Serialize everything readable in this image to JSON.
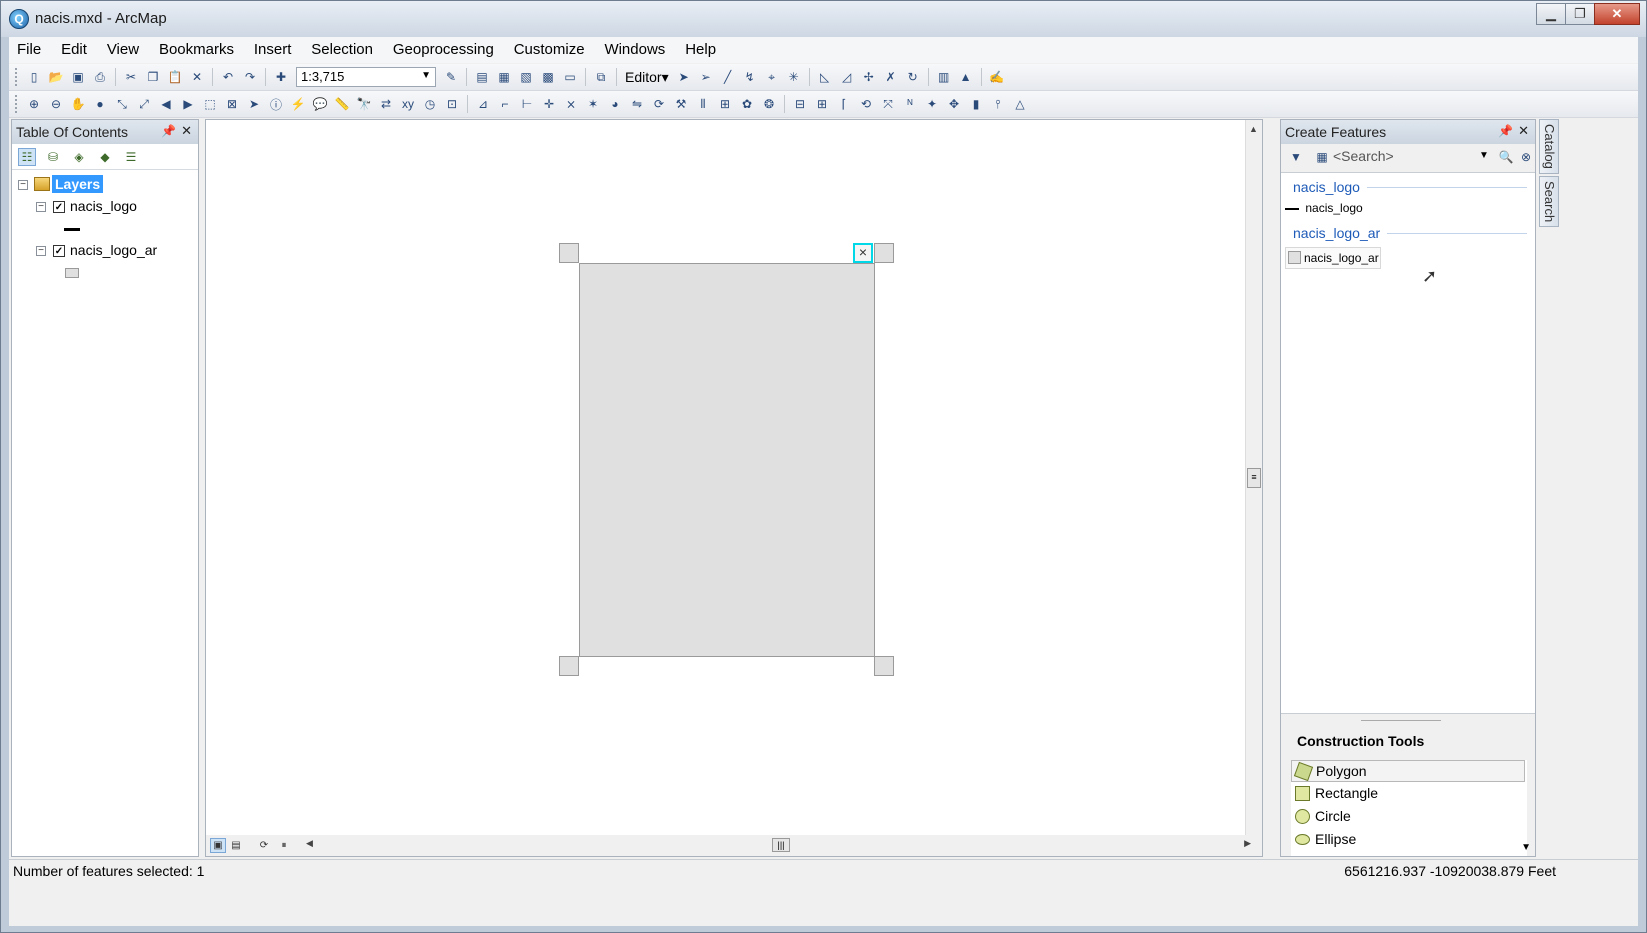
{
  "window": {
    "title": "nacis.mxd - ArcMap",
    "minimize": "▁",
    "maximize": "❐",
    "close": "✕"
  },
  "menu": [
    "File",
    "Edit",
    "View",
    "Bookmarks",
    "Insert",
    "Selection",
    "Geoprocessing",
    "Customize",
    "Windows",
    "Help"
  ],
  "toolbar": {
    "scale": "1:3,715",
    "editor_label": "Editor▾"
  },
  "toc": {
    "title": "Table Of Contents",
    "root_label": "Layers",
    "layers": [
      {
        "name": "nacis_logo",
        "checked": true,
        "symbol": "line"
      },
      {
        "name": "nacis_logo_ar",
        "checked": true,
        "symbol": "polygon"
      }
    ]
  },
  "create_features": {
    "title": "Create Features",
    "search_placeholder": "<Search>",
    "groups": [
      {
        "title": "nacis_logo",
        "template": "nacis_logo"
      },
      {
        "title": "nacis_logo_ar",
        "template": "nacis_logo_ar"
      }
    ],
    "construction_title": "Construction Tools",
    "construction_tools": [
      "Polygon",
      "Rectangle",
      "Circle",
      "Ellipse"
    ]
  },
  "side_tabs": [
    "Catalog",
    "Search"
  ],
  "status": {
    "left": "Number of features selected: 1",
    "coords": "6561216.937  -10920038.879 Feet"
  },
  "colors": {
    "selection_handle": "#00d8e8",
    "polygon_fill": "#e0e0e0",
    "layers_highlight": "#3399ff"
  }
}
